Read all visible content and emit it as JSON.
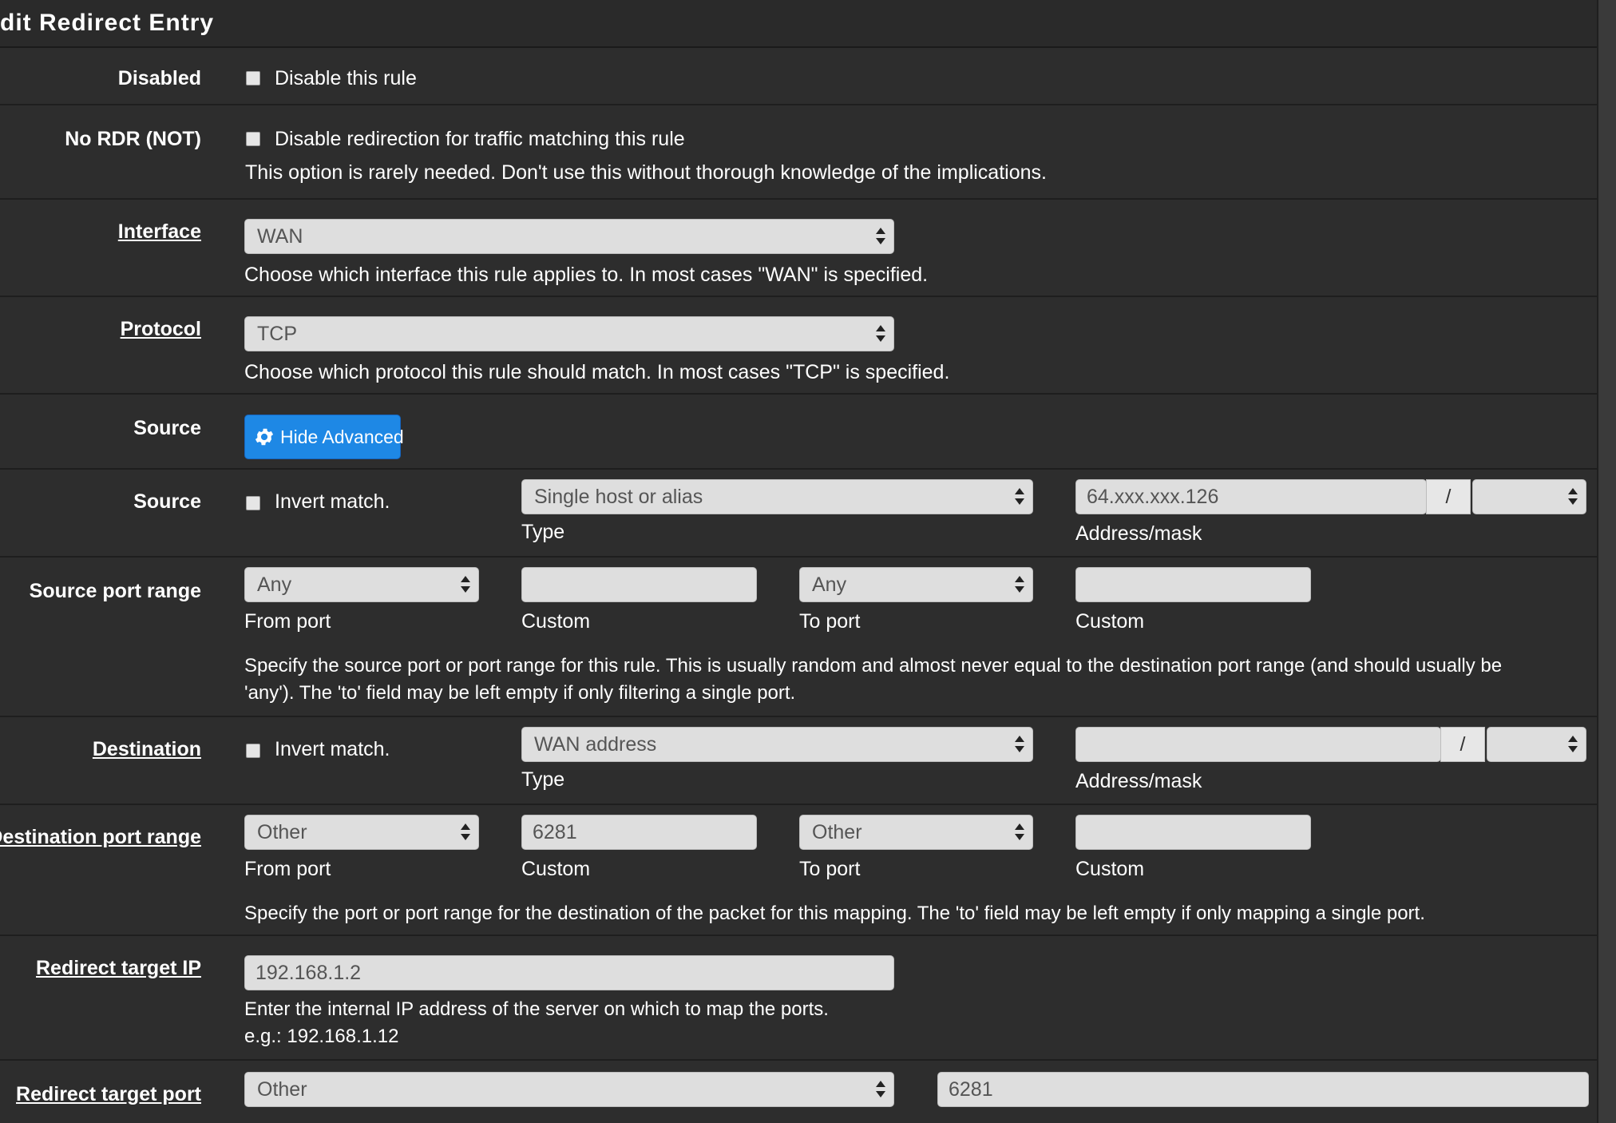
{
  "panel": {
    "title": "dit Redirect Entry"
  },
  "disabled": {
    "label": "Disabled",
    "checkbox_label": "Disable this rule"
  },
  "nordr": {
    "label": "No RDR (NOT)",
    "checkbox_label": "Disable redirection for traffic matching this rule",
    "help": "This option is rarely needed. Don't use this without thorough knowledge of the implications."
  },
  "interface": {
    "label": "Interface",
    "value": "WAN",
    "help": "Choose which interface this rule applies to. In most cases \"WAN\" is specified."
  },
  "protocol": {
    "label": "Protocol",
    "value": "TCP",
    "help": "Choose which protocol this rule should match. In most cases \"TCP\" is specified."
  },
  "source_adv": {
    "label": "Source",
    "button_label": "Hide Advanced"
  },
  "source": {
    "label": "Source",
    "invert_label": "Invert match.",
    "type_value": "Single host or alias",
    "type_caption": "Type",
    "address_value": "64.xxx.xxx.126",
    "slash": "/",
    "mask_value": "",
    "address_caption": "Address/mask"
  },
  "source_port": {
    "label": "Source port range",
    "from_value": "Any",
    "from_caption": "From port",
    "from_custom": "",
    "from_custom_caption": "Custom",
    "to_value": "Any",
    "to_caption": "To port",
    "to_custom": "",
    "to_custom_caption": "Custom",
    "help_line1": "Specify the source port or port range for this rule. This is usually random and almost never equal to the destination port range (and should usually be",
    "help_line2": "'any'). The 'to' field may be left empty if only filtering a single port."
  },
  "destination": {
    "label": "Destination",
    "invert_label": "Invert match.",
    "type_value": "WAN address",
    "type_caption": "Type",
    "address_value": "",
    "slash": "/",
    "mask_value": "",
    "address_caption": "Address/mask"
  },
  "dest_port": {
    "label": "Destination port range",
    "from_value": "Other",
    "from_caption": "From port",
    "from_custom": "6281",
    "from_custom_caption": "Custom",
    "to_value": "Other",
    "to_caption": "To port",
    "to_custom": "",
    "to_custom_caption": "Custom",
    "help": "Specify the port or port range for the destination of the packet for this mapping. The 'to' field may be left empty if only mapping a single port."
  },
  "redirect_ip": {
    "label": "Redirect target IP",
    "value": "192.168.1.2",
    "help_line1": "Enter the internal IP address of the server on which to map the ports.",
    "help_line2": "e.g.: 192.168.1.12"
  },
  "redirect_port": {
    "label": "Redirect target port",
    "select_value": "Other",
    "custom_value": "6281"
  }
}
